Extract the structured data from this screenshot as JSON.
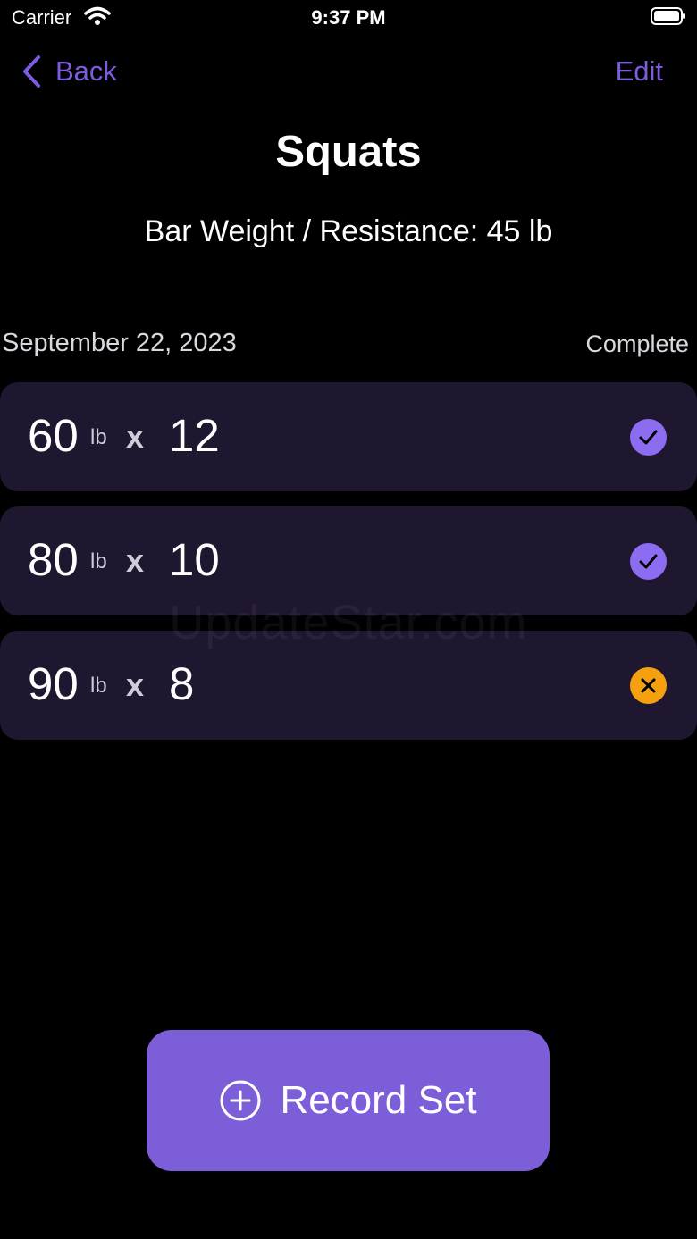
{
  "status_bar": {
    "carrier": "Carrier",
    "time": "9:37 PM"
  },
  "nav": {
    "back_label": "Back",
    "edit_label": "Edit"
  },
  "header": {
    "title": "Squats",
    "subtitle": "Bar Weight / Resistance: 45 lb"
  },
  "section": {
    "date": "September 22, 2023",
    "status": "Complete"
  },
  "sets": [
    {
      "weight": "60",
      "unit": "lb",
      "times": "x",
      "reps": "12",
      "status_icon": "checkmark-icon",
      "status_color": "#8c6cf0"
    },
    {
      "weight": "80",
      "unit": "lb",
      "times": "x",
      "reps": "10",
      "status_icon": "checkmark-icon",
      "status_color": "#8c6cf0"
    },
    {
      "weight": "90",
      "unit": "lb",
      "times": "x",
      "reps": "8",
      "status_icon": "xmark-icon",
      "status_color": "#f5a00f"
    }
  ],
  "watermark": "UpdateStar.com",
  "record_button": {
    "label": "Record Set",
    "icon": "plus-circle-icon",
    "color": "#7d5ed9"
  },
  "colors": {
    "accent": "#7d5ce0",
    "row_background": "#1f1630",
    "background": "#000000"
  }
}
